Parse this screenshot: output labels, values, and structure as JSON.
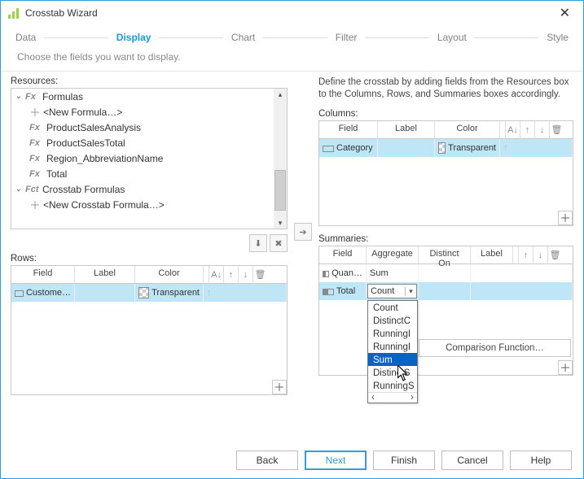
{
  "title": "Crosstab Wizard",
  "steps": [
    "Data",
    "Display",
    "Chart",
    "Filter",
    "Layout",
    "Style"
  ],
  "active_step": "Display",
  "subtitle": "Choose the fields you want to display.",
  "left": {
    "resources_label": "Resources:",
    "rows_label": "Rows:",
    "tree": {
      "formulas_label": "Formulas",
      "new_formula": "<New Formula…>",
      "items": [
        "ProductSalesAnalysis",
        "ProductSalesTotal",
        "Region_AbbreviationName",
        "Total"
      ],
      "crosstab_label": "Crosstab Formulas",
      "new_crosstab": "<New Crosstab Formula…>"
    },
    "rows_grid": {
      "headers": {
        "field": "Field",
        "label": "Label",
        "color": "Color"
      },
      "row": {
        "field": "Custome…",
        "color": "Transparent"
      }
    }
  },
  "right": {
    "desc": "Define the crosstab by adding fields from the Resources box to the Columns, Rows, and Summaries boxes accordingly.",
    "columns_label": "Columns:",
    "summaries_label": "Summaries:",
    "columns_grid": {
      "headers": {
        "field": "Field",
        "label": "Label",
        "color": "Color"
      },
      "row": {
        "field": "Category",
        "color": "Transparent"
      }
    },
    "summaries_grid": {
      "headers": {
        "field": "Field",
        "aggregate": "Aggregate",
        "distinct": "Distinct On",
        "label": "Label"
      },
      "rows": [
        {
          "field": "Quan…",
          "aggregate": "Sum"
        },
        {
          "field": "Total",
          "aggregate": "Count"
        }
      ],
      "dropdown": [
        "Count",
        "DistinctC",
        "RunningI",
        "RunningI",
        "Sum",
        "DistinctS",
        "RunningS"
      ],
      "dropdown_hl": "Sum",
      "comparison": "Comparison Function…"
    }
  },
  "buttons": {
    "back": "Back",
    "next": "Next",
    "finish": "Finish",
    "cancel": "Cancel",
    "help": "Help"
  }
}
